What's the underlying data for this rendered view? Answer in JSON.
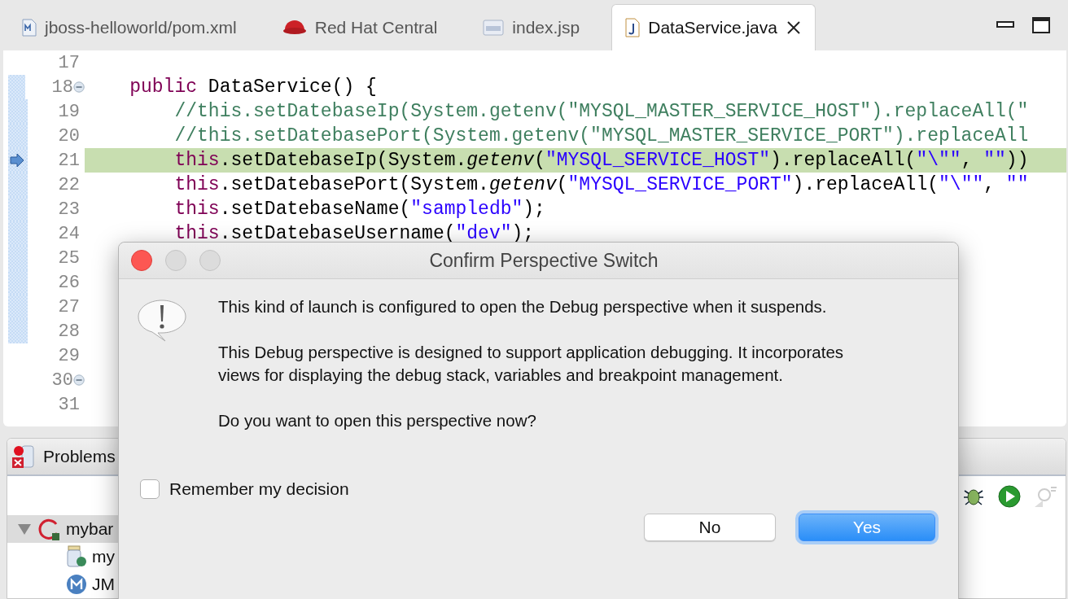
{
  "editor_tabs": [
    {
      "label": "jboss-helloworld/pom.xml",
      "kind": "xml",
      "selected": false
    },
    {
      "label": "Red Hat Central",
      "kind": "redhat",
      "selected": false
    },
    {
      "label": "index.jsp",
      "kind": "jsp",
      "selected": false
    },
    {
      "label": "DataService.java",
      "kind": "java",
      "selected": true,
      "closable": true
    }
  ],
  "code_lines": [
    {
      "number": "17",
      "annotated": false
    },
    {
      "number": "18",
      "folding": true,
      "annotated": true,
      "segments": [
        {
          "kind": "keyword",
          "text": "    public"
        },
        {
          "kind": "plain",
          "text": " DataService() {"
        }
      ]
    },
    {
      "number": "19",
      "annotated": true,
      "segments": [
        {
          "kind": "comment",
          "text": "        //this.setDatebaseIp(System.getenv(\"MYSQL_MASTER_SERVICE_HOST\").replaceAll(\""
        }
      ]
    },
    {
      "number": "20",
      "annotated": true,
      "segments": [
        {
          "kind": "comment",
          "text": "        //this.setDatebasePort(System.getenv(\"MYSQL_MASTER_SERVICE_PORT\").replaceAll"
        }
      ]
    },
    {
      "number": "21",
      "annotated": true,
      "current": true,
      "segments": [
        {
          "kind": "keyword",
          "text": "        this"
        },
        {
          "kind": "plain",
          "text": ".setDatebaseIp(System."
        },
        {
          "kind": "italic",
          "text": "getenv"
        },
        {
          "kind": "plain",
          "text": "("
        },
        {
          "kind": "string",
          "text": "\"MYSQL_SERVICE_HOST\""
        },
        {
          "kind": "plain",
          "text": ").replaceAll("
        },
        {
          "kind": "string",
          "text": "\"\\\"\""
        },
        {
          "kind": "plain",
          "text": ", "
        },
        {
          "kind": "string",
          "text": "\"\""
        },
        {
          "kind": "plain",
          "text": "))"
        }
      ]
    },
    {
      "number": "22",
      "annotated": true,
      "segments": [
        {
          "kind": "keyword",
          "text": "        this"
        },
        {
          "kind": "plain",
          "text": ".setDatebasePort(System."
        },
        {
          "kind": "italic",
          "text": "getenv"
        },
        {
          "kind": "plain",
          "text": "("
        },
        {
          "kind": "string",
          "text": "\"MYSQL_SERVICE_PORT\""
        },
        {
          "kind": "plain",
          "text": ").replaceAll("
        },
        {
          "kind": "string",
          "text": "\"\\\"\""
        },
        {
          "kind": "plain",
          "text": ", "
        },
        {
          "kind": "string",
          "text": "\"\""
        }
      ]
    },
    {
      "number": "23",
      "annotated": true,
      "segments": [
        {
          "kind": "keyword",
          "text": "        this"
        },
        {
          "kind": "plain",
          "text": ".setDatebaseName("
        },
        {
          "kind": "string",
          "text": "\"sampledb\""
        },
        {
          "kind": "plain",
          "text": ");"
        }
      ]
    },
    {
      "number": "24",
      "annotated": true,
      "segments": [
        {
          "kind": "keyword",
          "text": "        this"
        },
        {
          "kind": "plain",
          "text": ".setDatebaseUsername("
        },
        {
          "kind": "string",
          "text": "\"dev\""
        },
        {
          "kind": "plain",
          "text": ");"
        }
      ]
    },
    {
      "number": "25",
      "annotated": true
    },
    {
      "number": "26",
      "annotated": true
    },
    {
      "number": "27",
      "annotated": true
    },
    {
      "number": "28",
      "annotated": true
    },
    {
      "number": "29",
      "annotated": false
    },
    {
      "number": "30",
      "folding": true,
      "annotated": false
    },
    {
      "number": "31",
      "annotated": false
    }
  ],
  "bottom_panel": {
    "tab": "Problems",
    "tree": [
      {
        "label": "mybar",
        "selected": true,
        "expanded": true,
        "children": [
          {
            "label": "my",
            "kind": "jar"
          },
          {
            "label": "JM",
            "kind": "maven"
          }
        ]
      }
    ]
  },
  "dialog": {
    "title": "Confirm Perspective Switch",
    "paragraphs": [
      "This kind of launch is configured to open the Debug perspective when it suspends.",
      "This Debug perspective is designed to support application debugging.  It incorporates views for displaying the debug stack, variables and breakpoint management.",
      "Do you want to open this perspective now?"
    ],
    "checkbox": {
      "label": "Remember my decision",
      "checked": false
    },
    "buttons": [
      {
        "label": "No",
        "default": false
      },
      {
        "label": "Yes",
        "default": true
      }
    ]
  }
}
